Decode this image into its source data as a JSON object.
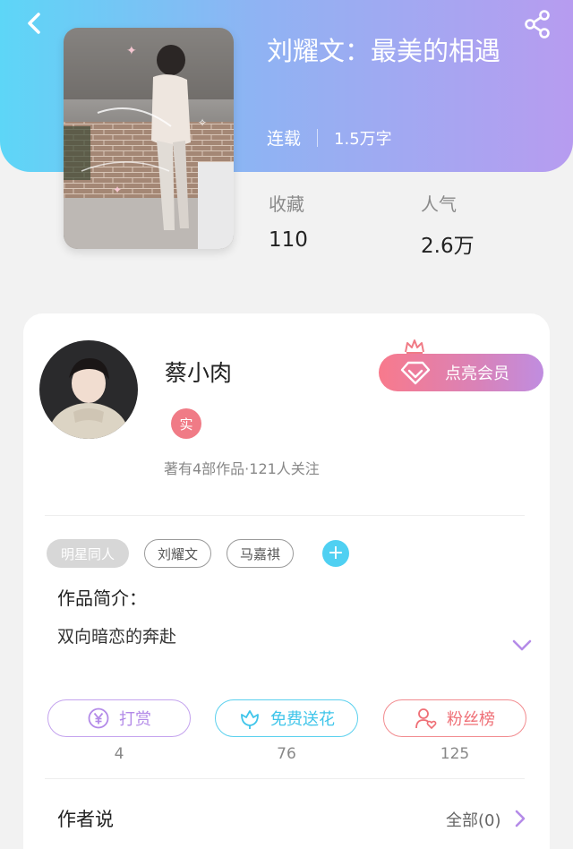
{
  "book": {
    "title": "刘耀文：最美的相遇",
    "status": "连载",
    "word_count": "1.5万字",
    "stats": [
      {
        "label": "收藏",
        "value": "110"
      },
      {
        "label": "人气",
        "value": "2.6万"
      }
    ]
  },
  "author": {
    "name": "蔡小肉",
    "badge": "实",
    "summary": "著有4部作品·121人关注"
  },
  "vip_button": "点亮会员",
  "tags": [
    "明星同人",
    "刘耀文",
    "马嘉祺"
  ],
  "tag_add_symbol": "+",
  "intro": {
    "label": "作品简介：",
    "text": "双向暗恋的奔赴"
  },
  "actions": [
    {
      "label": "打赏",
      "count": "4",
      "icon": "yen-coin-icon"
    },
    {
      "label": "免费送花",
      "count": "76",
      "icon": "flower-icon"
    },
    {
      "label": "粉丝榜",
      "count": "125",
      "icon": "fan-heart-icon"
    }
  ],
  "author_says": {
    "title": "作者说",
    "see_all": "全部(0)"
  },
  "colors": {
    "header_gradient_start": "#5dd6f7",
    "header_gradient_end": "#b79cf0",
    "vip_gradient_start": "#f87a8c",
    "vip_gradient_end": "#c08de0",
    "reward": "#b38ae8",
    "flower": "#3fc5ea",
    "fans": "#ef6f76",
    "tag_add": "#4fd0f2",
    "real_badge": "#f07b86"
  }
}
